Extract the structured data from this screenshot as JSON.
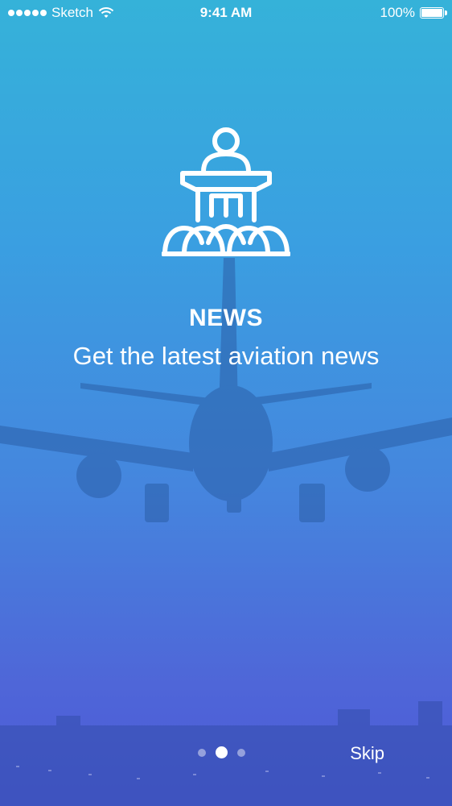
{
  "status_bar": {
    "carrier": "Sketch",
    "time": "9:41 AM",
    "battery_percent": "100%",
    "signal_bars": 5,
    "wifi_icon": "wifi-icon",
    "battery_icon": "battery-icon"
  },
  "onboarding": {
    "icon": "podium-speaker-audience-icon",
    "title": "NEWS",
    "subtitle": "Get the latest aviation news",
    "background": "airplane-landing-photo"
  },
  "pager": {
    "total_pages": 3,
    "current_page": 2
  },
  "actions": {
    "skip_label": "Skip"
  },
  "colors": {
    "gradient_top": "#35b2d9",
    "gradient_bottom": "#4b58d6",
    "text": "#ffffff"
  }
}
